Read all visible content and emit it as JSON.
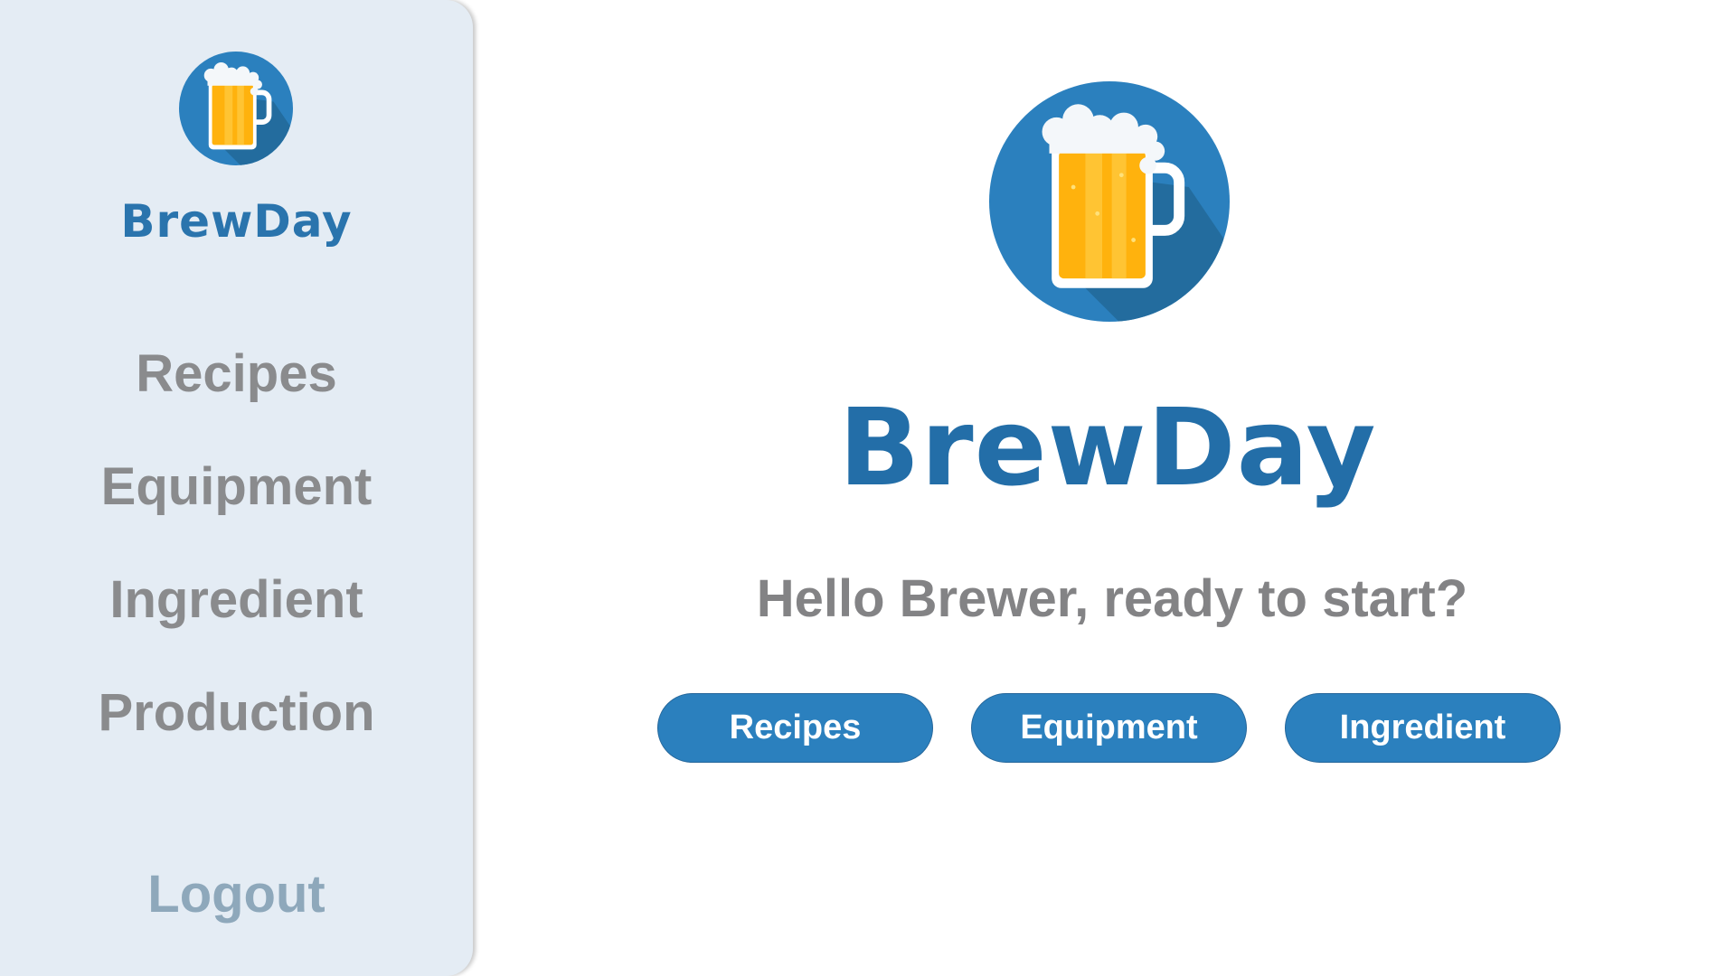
{
  "app": {
    "name": "BrewDay",
    "logo_icon": "beer-mug-icon",
    "colors": {
      "brand_blue": "#2a74ad",
      "sidebar_background": "#e4ecf4",
      "nav_text": "#8a8b8d",
      "logout_text": "#8ea8bb",
      "button_background": "#2b80be",
      "beer_amber": "#ffb20d"
    }
  },
  "sidebar": {
    "brand": "BrewDay",
    "items": [
      {
        "label": "Recipes"
      },
      {
        "label": "Equipment"
      },
      {
        "label": "Ingredient"
      },
      {
        "label": "Production"
      }
    ],
    "logout_label": "Logout"
  },
  "main": {
    "title": "BrewDay",
    "greeting": "Hello Brewer, ready to start?",
    "buttons": [
      {
        "label": "Recipes"
      },
      {
        "label": "Equipment"
      },
      {
        "label": "Ingredient"
      }
    ]
  }
}
